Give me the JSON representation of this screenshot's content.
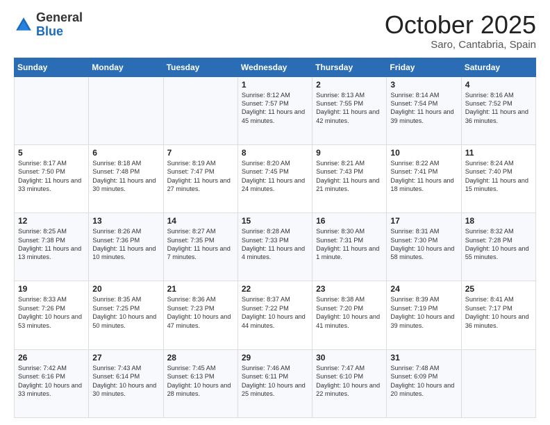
{
  "header": {
    "logo_general": "General",
    "logo_blue": "Blue",
    "month_title": "October 2025",
    "location": "Saro, Cantabria, Spain"
  },
  "weekdays": [
    "Sunday",
    "Monday",
    "Tuesday",
    "Wednesday",
    "Thursday",
    "Friday",
    "Saturday"
  ],
  "weeks": [
    [
      {
        "day": "",
        "text": ""
      },
      {
        "day": "",
        "text": ""
      },
      {
        "day": "",
        "text": ""
      },
      {
        "day": "1",
        "text": "Sunrise: 8:12 AM\nSunset: 7:57 PM\nDaylight: 11 hours and 45 minutes."
      },
      {
        "day": "2",
        "text": "Sunrise: 8:13 AM\nSunset: 7:55 PM\nDaylight: 11 hours and 42 minutes."
      },
      {
        "day": "3",
        "text": "Sunrise: 8:14 AM\nSunset: 7:54 PM\nDaylight: 11 hours and 39 minutes."
      },
      {
        "day": "4",
        "text": "Sunrise: 8:16 AM\nSunset: 7:52 PM\nDaylight: 11 hours and 36 minutes."
      }
    ],
    [
      {
        "day": "5",
        "text": "Sunrise: 8:17 AM\nSunset: 7:50 PM\nDaylight: 11 hours and 33 minutes."
      },
      {
        "day": "6",
        "text": "Sunrise: 8:18 AM\nSunset: 7:48 PM\nDaylight: 11 hours and 30 minutes."
      },
      {
        "day": "7",
        "text": "Sunrise: 8:19 AM\nSunset: 7:47 PM\nDaylight: 11 hours and 27 minutes."
      },
      {
        "day": "8",
        "text": "Sunrise: 8:20 AM\nSunset: 7:45 PM\nDaylight: 11 hours and 24 minutes."
      },
      {
        "day": "9",
        "text": "Sunrise: 8:21 AM\nSunset: 7:43 PM\nDaylight: 11 hours and 21 minutes."
      },
      {
        "day": "10",
        "text": "Sunrise: 8:22 AM\nSunset: 7:41 PM\nDaylight: 11 hours and 18 minutes."
      },
      {
        "day": "11",
        "text": "Sunrise: 8:24 AM\nSunset: 7:40 PM\nDaylight: 11 hours and 15 minutes."
      }
    ],
    [
      {
        "day": "12",
        "text": "Sunrise: 8:25 AM\nSunset: 7:38 PM\nDaylight: 11 hours and 13 minutes."
      },
      {
        "day": "13",
        "text": "Sunrise: 8:26 AM\nSunset: 7:36 PM\nDaylight: 11 hours and 10 minutes."
      },
      {
        "day": "14",
        "text": "Sunrise: 8:27 AM\nSunset: 7:35 PM\nDaylight: 11 hours and 7 minutes."
      },
      {
        "day": "15",
        "text": "Sunrise: 8:28 AM\nSunset: 7:33 PM\nDaylight: 11 hours and 4 minutes."
      },
      {
        "day": "16",
        "text": "Sunrise: 8:30 AM\nSunset: 7:31 PM\nDaylight: 11 hours and 1 minute."
      },
      {
        "day": "17",
        "text": "Sunrise: 8:31 AM\nSunset: 7:30 PM\nDaylight: 10 hours and 58 minutes."
      },
      {
        "day": "18",
        "text": "Sunrise: 8:32 AM\nSunset: 7:28 PM\nDaylight: 10 hours and 55 minutes."
      }
    ],
    [
      {
        "day": "19",
        "text": "Sunrise: 8:33 AM\nSunset: 7:26 PM\nDaylight: 10 hours and 53 minutes."
      },
      {
        "day": "20",
        "text": "Sunrise: 8:35 AM\nSunset: 7:25 PM\nDaylight: 10 hours and 50 minutes."
      },
      {
        "day": "21",
        "text": "Sunrise: 8:36 AM\nSunset: 7:23 PM\nDaylight: 10 hours and 47 minutes."
      },
      {
        "day": "22",
        "text": "Sunrise: 8:37 AM\nSunset: 7:22 PM\nDaylight: 10 hours and 44 minutes."
      },
      {
        "day": "23",
        "text": "Sunrise: 8:38 AM\nSunset: 7:20 PM\nDaylight: 10 hours and 41 minutes."
      },
      {
        "day": "24",
        "text": "Sunrise: 8:39 AM\nSunset: 7:19 PM\nDaylight: 10 hours and 39 minutes."
      },
      {
        "day": "25",
        "text": "Sunrise: 8:41 AM\nSunset: 7:17 PM\nDaylight: 10 hours and 36 minutes."
      }
    ],
    [
      {
        "day": "26",
        "text": "Sunrise: 7:42 AM\nSunset: 6:16 PM\nDaylight: 10 hours and 33 minutes."
      },
      {
        "day": "27",
        "text": "Sunrise: 7:43 AM\nSunset: 6:14 PM\nDaylight: 10 hours and 30 minutes."
      },
      {
        "day": "28",
        "text": "Sunrise: 7:45 AM\nSunset: 6:13 PM\nDaylight: 10 hours and 28 minutes."
      },
      {
        "day": "29",
        "text": "Sunrise: 7:46 AM\nSunset: 6:11 PM\nDaylight: 10 hours and 25 minutes."
      },
      {
        "day": "30",
        "text": "Sunrise: 7:47 AM\nSunset: 6:10 PM\nDaylight: 10 hours and 22 minutes."
      },
      {
        "day": "31",
        "text": "Sunrise: 7:48 AM\nSunset: 6:09 PM\nDaylight: 10 hours and 20 minutes."
      },
      {
        "day": "",
        "text": ""
      }
    ]
  ]
}
